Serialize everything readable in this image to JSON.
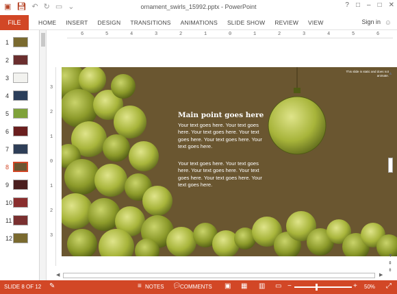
{
  "window": {
    "title": "ornament_swirls_15992.pptx - PowerPoint",
    "controls": [
      "?",
      "□",
      "–",
      "□",
      "✕"
    ]
  },
  "ribbon": {
    "file": "FILE",
    "tabs": [
      "HOME",
      "INSERT",
      "DESIGN",
      "TRANSITIONS",
      "ANIMATIONS",
      "SLIDE SHOW",
      "REVIEW",
      "VIEW"
    ],
    "signin": "Sign in"
  },
  "thumbnails": [
    {
      "num": "1",
      "color": "#7a6a2f"
    },
    {
      "num": "2",
      "color": "#6a2e2e"
    },
    {
      "num": "3",
      "color": "#f2f2ef"
    },
    {
      "num": "4",
      "color": "#2b3e5a"
    },
    {
      "num": "5",
      "color": "#7fa23a"
    },
    {
      "num": "6",
      "color": "#6a1e1e"
    },
    {
      "num": "7",
      "color": "#2e3e57"
    },
    {
      "num": "8",
      "color": "#6a5630"
    },
    {
      "num": "9",
      "color": "#4a1e1e"
    },
    {
      "num": "10",
      "color": "#8a2e2e"
    },
    {
      "num": "11",
      "color": "#7a3030"
    },
    {
      "num": "12",
      "color": "#7a6a2f"
    }
  ],
  "ruler": {
    "horizontal": [
      "6",
      "5",
      "4",
      "3",
      "2",
      "1",
      "0",
      "1",
      "2",
      "3",
      "4",
      "5",
      "6"
    ],
    "vertical": [
      "3",
      "2",
      "1",
      "0",
      "1",
      "2",
      "3"
    ]
  },
  "slide": {
    "background": "#6a5630",
    "title": "Main point goes here",
    "paragraph1": "Your text goes here. Your text goes here. Your text goes here. Your text goes here. Your text goes here. Your text goes here.",
    "paragraph2": "Your text goes here. Your text goes here. Your text goes here. Your text goes here. Your text goes here. Your text goes here.",
    "note": "This slide is static and does not animate."
  },
  "status": {
    "slide_indicator": "SLIDE 8 OF 12",
    "notes": "NOTES",
    "comments": "COMMENTS",
    "zoom": "50%",
    "accent": "#d24726"
  }
}
